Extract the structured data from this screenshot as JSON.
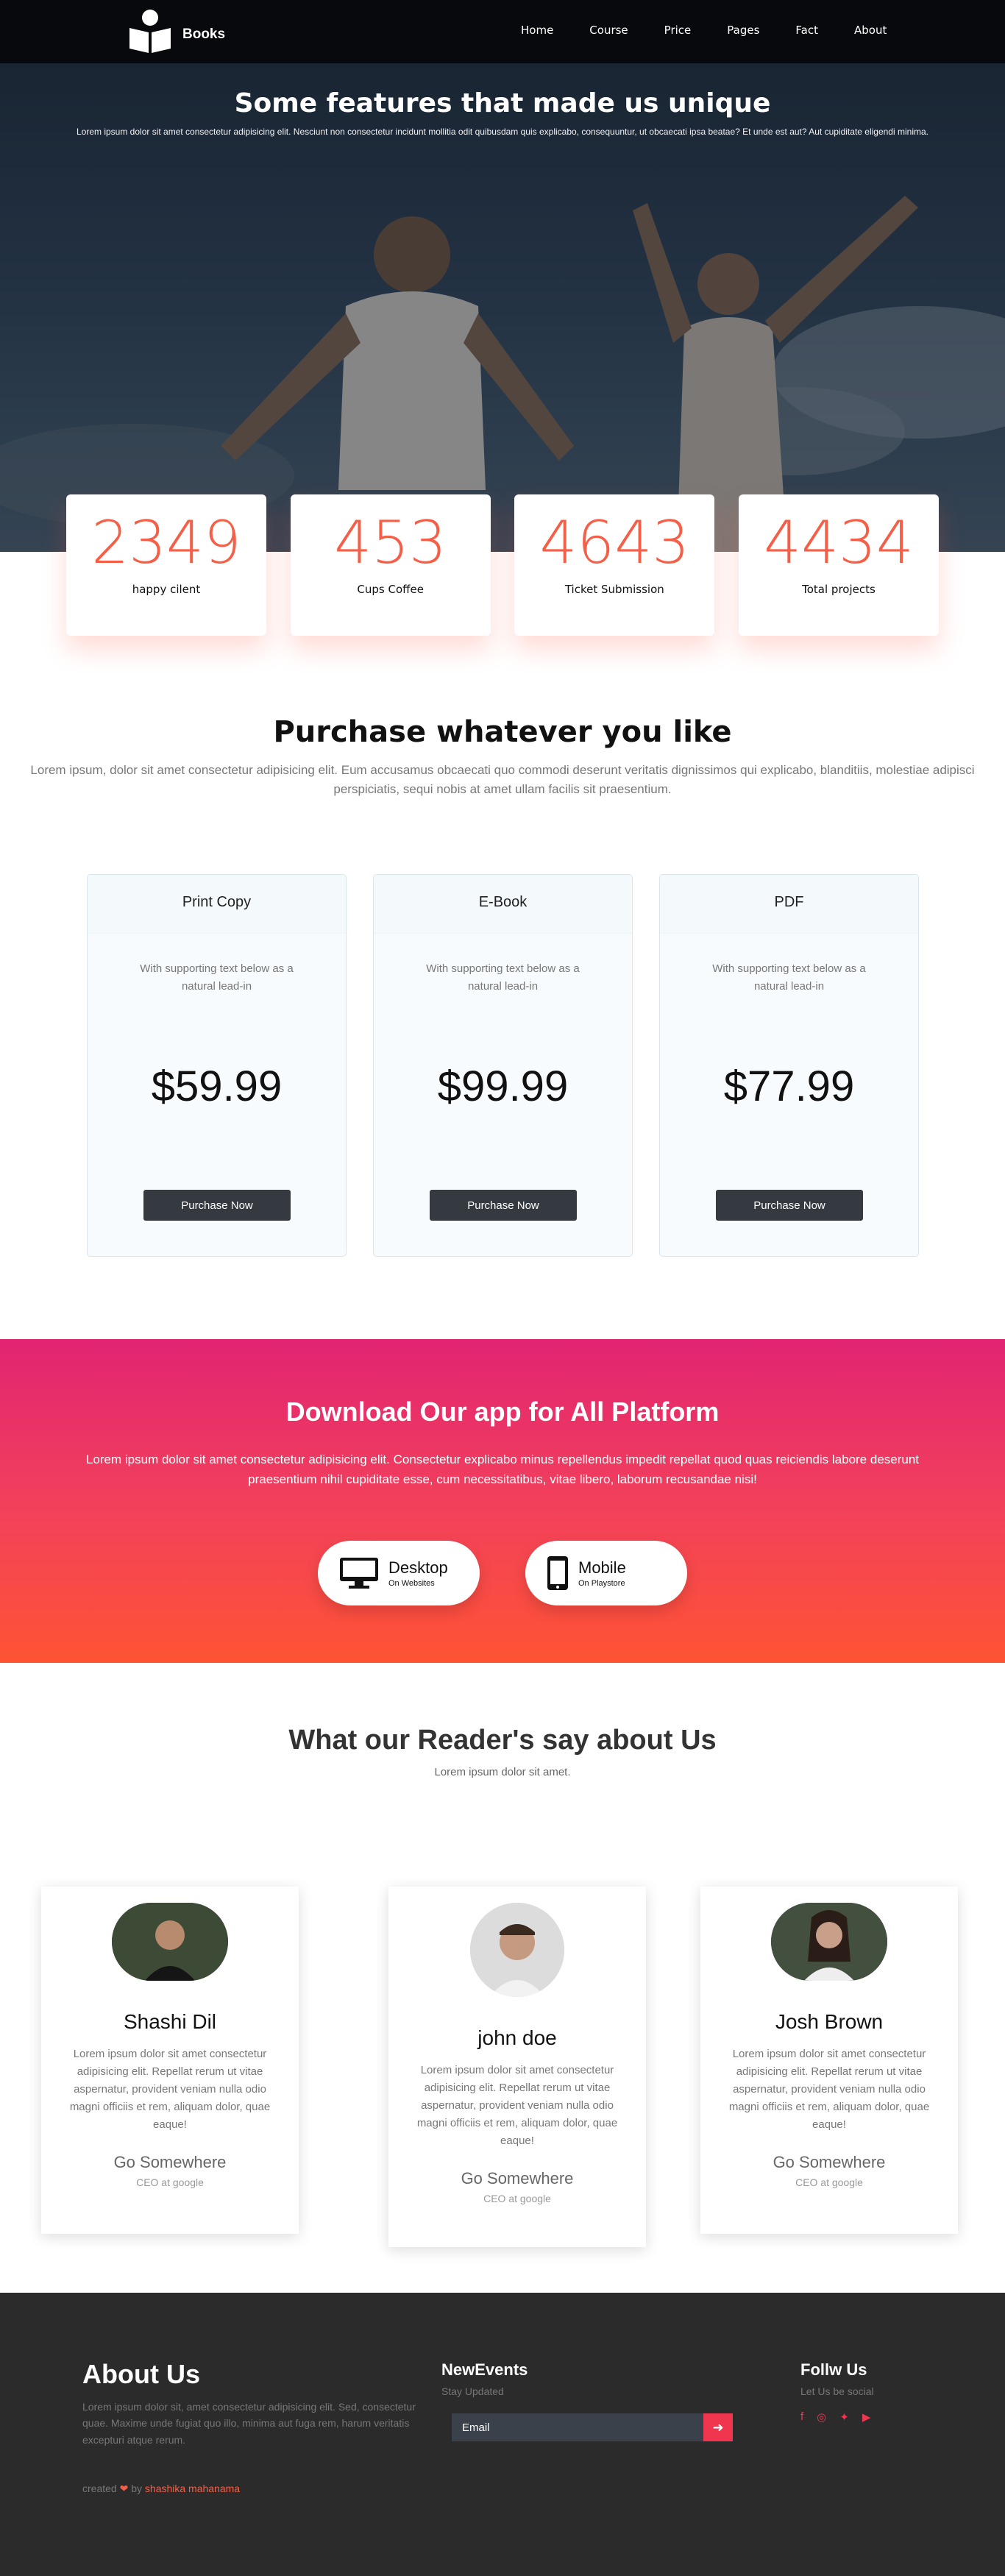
{
  "nav": {
    "brand": "Books",
    "items": [
      "Home",
      "Course",
      "Price",
      "Pages",
      "Fact",
      "About"
    ]
  },
  "hero": {
    "title": "Some features that made us unique",
    "subtitle": "Lorem ipsum dolor sit amet consectetur adipisicing elit. Nesciunt non consectetur incidunt mollitia odit quibusdam quis explicabo, consequuntur, ut obcaecati ipsa beatae? Et unde est aut? Aut cupiditate eligendi minima."
  },
  "stats": [
    {
      "value": "2349",
      "label": "happy cilent"
    },
    {
      "value": "453",
      "label": "Cups Coffee"
    },
    {
      "value": "4643",
      "label": "Ticket Submission"
    },
    {
      "value": "4434",
      "label": "Total projects"
    }
  ],
  "purchase": {
    "title": "Purchase whatever you like",
    "subtitle": "Lorem ipsum, dolor sit amet consectetur adipisicing elit. Eum accusamus obcaecati quo commodi deserunt veritatis dignissimos qui explicabo, blanditiis, molestiae adipisci perspiciatis, sequi nobis at amet ullam facilis sit praesentium.",
    "plans": [
      {
        "name": "Print Copy",
        "desc": "With supporting text below as a natural lead-in",
        "price": "$59.99",
        "button": "Purchase Now"
      },
      {
        "name": "E-Book",
        "desc": "With supporting text below as a natural lead-in",
        "price": "$99.99",
        "button": "Purchase Now"
      },
      {
        "name": "PDF",
        "desc": "With supporting text below as a natural lead-in",
        "price": "$77.99",
        "button": "Purchase Now"
      }
    ]
  },
  "app": {
    "title": "Download Our app for All Platform",
    "subtitle": "Lorem ipsum dolor sit amet consectetur adipisicing elit. Consectetur explicabo minus repellendus impedit repellat quod quas reiciendis labore deserunt praesentium nihil cupiditate esse, cum necessitatibus, vitae libero, laborum recusandae nisi!",
    "buttons": [
      {
        "title": "Desktop",
        "sub": "On Websites",
        "icon": "desktop-icon"
      },
      {
        "title": "Mobile",
        "sub": "On Playstore",
        "icon": "mobile-icon"
      }
    ]
  },
  "testimonials": {
    "title": "What our Reader's say about Us",
    "subtitle": "Lorem ipsum dolor sit amet.",
    "cards": [
      {
        "name": "Shashi Dil",
        "body": "Lorem ipsum dolor sit amet consectetur adipisicing elit. Repellat rerum ut vitae aspernatur, provident veniam nulla odio magni officiis et rem, aliquam dolor, quae eaque!",
        "link": "Go Somewhere",
        "role": "CEO at google"
      },
      {
        "name": "john doe",
        "body": "Lorem ipsum dolor sit amet consectetur adipisicing elit. Repellat rerum ut vitae aspernatur, provident veniam nulla odio magni officiis et rem, aliquam dolor, quae eaque!",
        "link": "Go Somewhere",
        "role": "CEO at google"
      },
      {
        "name": "Josh Brown",
        "body": "Lorem ipsum dolor sit amet consectetur adipisicing elit. Repellat rerum ut vitae aspernatur, provident veniam nulla odio magni officiis et rem, aliquam dolor, quae eaque!",
        "link": "Go Somewhere",
        "role": "CEO at google"
      }
    ]
  },
  "footer": {
    "about_title": "About Us",
    "about_text": "Lorem ipsum dolor sit, amet consectetur adipisicing elit. Sed, consectetur quae. Maxime unde fugiat quo illo, minima aut fuga rem, harum veritatis excepturi atque rerum.",
    "created_prefix": "created",
    "created_by": "by",
    "author": "shashika mahanama",
    "events_title": "NewEvents",
    "events_sub": "Stay Updated",
    "email_placeholder": "Email",
    "follow_title": "Follw Us",
    "follow_sub": "Let Us be social",
    "socials": [
      "facebook-icon",
      "instagram-icon",
      "twitter-icon",
      "youtube-icon"
    ]
  },
  "colors": {
    "accent": "#f55f48",
    "nav_bg": "#07090c",
    "footer_bg": "#2b2b2b",
    "gradient_top": "#e22472",
    "gradient_bottom": "#ff5333"
  }
}
